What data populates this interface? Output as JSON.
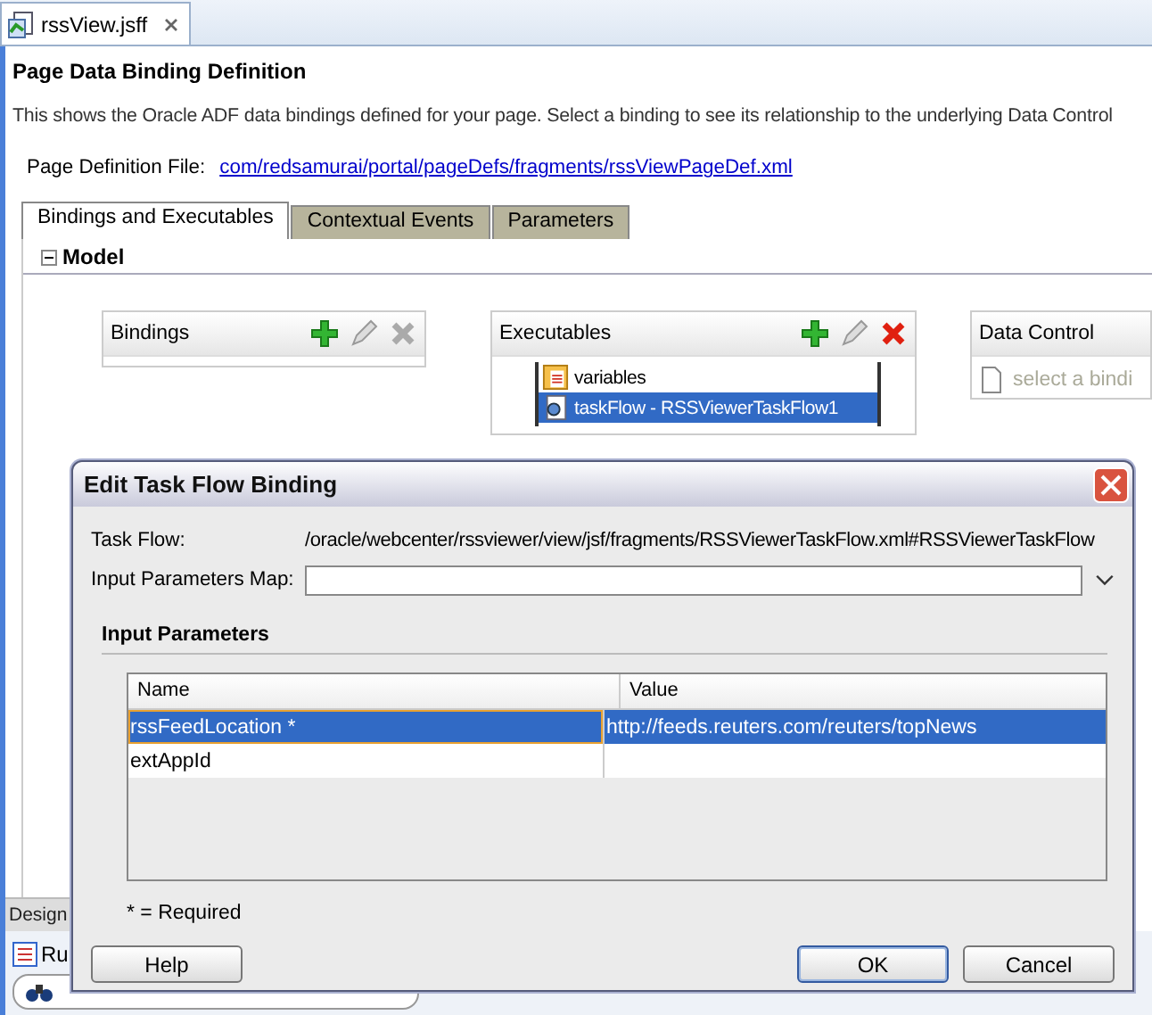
{
  "editor_tab": {
    "label": "rssView.jsff",
    "selected": true
  },
  "page": {
    "title": "Page Data Binding Definition",
    "description": "This shows the Oracle ADF data bindings defined for your page. Select a binding to see its relationship to the underlying Data Control",
    "definition_file": {
      "label": "Page Definition File:",
      "link": "com/redsamurai/portal/pageDefs/fragments/rssViewPageDef.xml"
    }
  },
  "tabs": [
    {
      "label": "Bindings and Executables",
      "selected": true
    },
    {
      "label": "Contextual Events",
      "selected": false
    },
    {
      "label": "Parameters",
      "selected": false
    }
  ],
  "section": {
    "title": "Model",
    "expanded": true
  },
  "bindings": {
    "title": "Bindings",
    "delete_enabled": false
  },
  "executables": {
    "title": "Executables",
    "delete_enabled": true,
    "items": [
      {
        "kind": "variables",
        "label": "variables",
        "selected": false
      },
      {
        "kind": "taskflow",
        "label": "taskFlow - RSSViewerTaskFlow1",
        "selected": true
      }
    ]
  },
  "data_control": {
    "title": "Data Control",
    "hint": "select a bindi"
  },
  "bottom": {
    "design_tab": "Design",
    "run_tab": "Ru"
  },
  "dialog": {
    "title": "Edit Task Flow Binding",
    "task_flow": {
      "label": "Task Flow:",
      "value": "/oracle/webcenter/rssviewer/view/jsf/fragments/RSSViewerTaskFlow.xml#RSSViewerTaskFlow"
    },
    "parameters_map": {
      "label": "Input Parameters Map:"
    },
    "section_title": "Input Parameters",
    "table": {
      "columns": [
        "Name",
        "Value"
      ],
      "rows": [
        {
          "name": "rssFeedLocation *",
          "value": "http://feeds.reuters.com/reuters/topNews",
          "selected": true
        },
        {
          "name": "extAppId",
          "value": "",
          "selected": false
        }
      ]
    },
    "note": "* = Required",
    "buttons": [
      {
        "kind": "help",
        "label": "Help",
        "default": false
      },
      {
        "kind": "ok",
        "label": "OK",
        "default": true
      },
      {
        "kind": "cancel",
        "label": "Cancel",
        "default": false
      }
    ]
  }
}
